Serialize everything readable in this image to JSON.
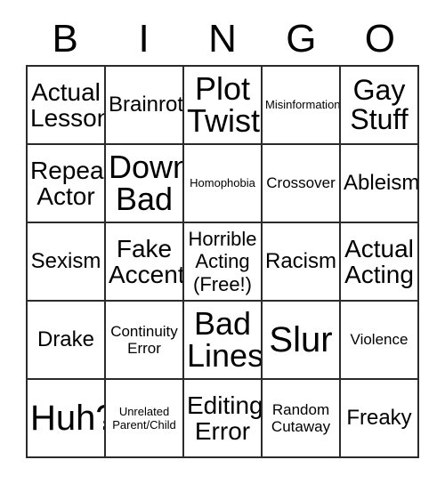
{
  "card": {
    "header_letters": [
      "B",
      "I",
      "N",
      "G",
      "O"
    ],
    "columns": 5,
    "rows": 5,
    "free_space_index": 12,
    "grid_line_color": "#2b2b2b",
    "background_color": "#ffffff",
    "text_color": "#000000",
    "cells": [
      {
        "text": "Actual\nLesson",
        "size": "lg"
      },
      {
        "text": "Brainrot",
        "size": "md"
      },
      {
        "text": "Plot\nTwist",
        "size": "xxl"
      },
      {
        "text": "Misinformation",
        "size": "xs"
      },
      {
        "text": "Gay\nStuff",
        "size": "xl"
      },
      {
        "text": "Repeat\nActor",
        "size": "lg"
      },
      {
        "text": "Down\nBad",
        "size": "xxl"
      },
      {
        "text": "Homophobia",
        "size": "xs"
      },
      {
        "text": "Crossover",
        "size": "sm"
      },
      {
        "text": "Ableism",
        "size": "md"
      },
      {
        "text": "Sexism",
        "size": "md"
      },
      {
        "text": "Fake\nAccent",
        "size": "lg"
      },
      {
        "text": "Horrible\nActing\n(Free!)",
        "size": "free"
      },
      {
        "text": "Racism",
        "size": "md"
      },
      {
        "text": "Actual\nActing",
        "size": "lg"
      },
      {
        "text": "Drake",
        "size": "md"
      },
      {
        "text": "Continuity\nError",
        "size": "sm"
      },
      {
        "text": "Bad\nLines",
        "size": "xxl"
      },
      {
        "text": "Slur",
        "size": "huge"
      },
      {
        "text": "Violence",
        "size": "sm"
      },
      {
        "text": "Huh?",
        "size": "huge"
      },
      {
        "text": "Unrelated\nParent/Child",
        "size": "xs"
      },
      {
        "text": "Editing\nError",
        "size": "lg"
      },
      {
        "text": "Random\nCutaway",
        "size": "sm"
      },
      {
        "text": "Freaky",
        "size": "md"
      }
    ]
  }
}
